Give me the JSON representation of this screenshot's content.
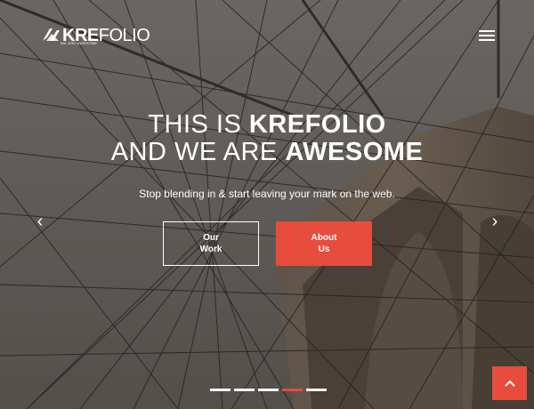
{
  "brand": {
    "logo_bold": "KRE",
    "logo_light": "FOLIO",
    "tagline": "WE ARE AWESOME"
  },
  "hero": {
    "line1_light": "THIS IS ",
    "line1_bold": "KREFOLIO",
    "line2_light": "AND WE ARE ",
    "line2_bold": "AWESOME",
    "subtitle": "Stop blending in & start leaving your mark on the web."
  },
  "buttons": {
    "work_line1": "Our",
    "work_line2": "Work",
    "about_line1": "About",
    "about_line2": "Us"
  },
  "slider": {
    "prev_icon": "‹",
    "next_icon": "›",
    "slide_count": 5,
    "active_index": 3
  },
  "colors": {
    "accent": "#e64d3c",
    "text": "#ffffff"
  },
  "icons": {
    "menu": "hamburger-menu-icon",
    "back_to_top": "chevron-up-icon"
  }
}
